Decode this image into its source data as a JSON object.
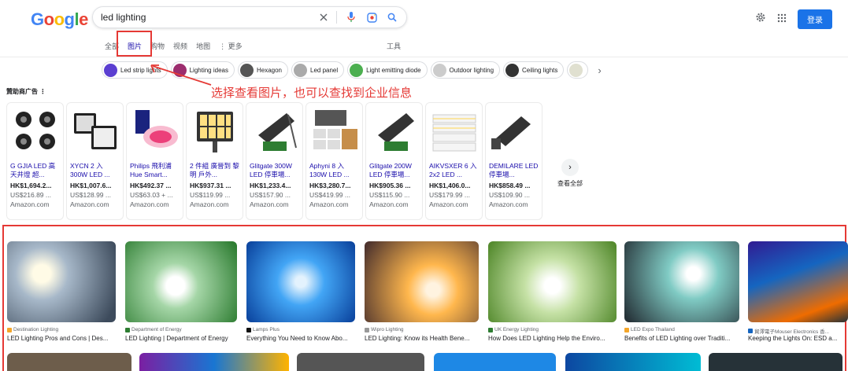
{
  "header": {
    "logo_letters": [
      {
        "ch": "G",
        "color": "#4285F4"
      },
      {
        "ch": "o",
        "color": "#EA4335"
      },
      {
        "ch": "o",
        "color": "#FBBC05"
      },
      {
        "ch": "g",
        "color": "#4285F4"
      },
      {
        "ch": "l",
        "color": "#34A853"
      },
      {
        "ch": "e",
        "color": "#EA4335"
      }
    ],
    "search_value": "led lighting",
    "signin_label": "登录"
  },
  "tabs": [
    {
      "label": "全部",
      "active": false
    },
    {
      "label": "图片",
      "active": true
    },
    {
      "label": "购物",
      "active": false
    },
    {
      "label": "视频",
      "active": false
    },
    {
      "label": "地图",
      "active": false
    },
    {
      "label": "⋮ 更多",
      "active": false
    }
  ],
  "tools_label": "工具",
  "chips": [
    {
      "label": "Led strip lights",
      "thumb": "#5b3fd1"
    },
    {
      "label": "Lighting ideas",
      "thumb": "#9c2d6e"
    },
    {
      "label": "Hexagon",
      "thumb": "#555555"
    },
    {
      "label": "Led panel",
      "thumb": "#aaaaaa"
    },
    {
      "label": "Light emitting diode",
      "thumb": "#4caf50"
    },
    {
      "label": "Outdoor lighting",
      "thumb": "#cccccc"
    },
    {
      "label": "Ceiling lights",
      "thumb": "#333333"
    },
    {
      "label": "",
      "thumb": "#e0e0d0"
    }
  ],
  "annotation": "选择查看图片，也可以查找到企业信息",
  "sponsored_label": "贊助商广告",
  "products": [
    {
      "title": "G GJIA LED 高天井燈 超...",
      "price": "HK$1,694.2...",
      "usd": "US$216.89 ...",
      "store": "Amazon.com"
    },
    {
      "title": "XYCN 2 入 300W LED ...",
      "price": "HK$1,007.6...",
      "usd": "US$128.99 ...",
      "store": "Amazon.com"
    },
    {
      "title": "Philips 飛利浦 Hue Smart...",
      "price": "HK$492.37 ...",
      "usd": "US$63.03 + ...",
      "store": "Amazon.com"
    },
    {
      "title": "2 件組 廣晉到 黎明 戶外...",
      "price": "HK$937.31 ...",
      "usd": "US$119.99 ...",
      "store": "Amazon.com"
    },
    {
      "title": "Glitgate 300W LED 停車場...",
      "price": "HK$1,233.4...",
      "usd": "US$157.90 ...",
      "store": "Amazon.com"
    },
    {
      "title": "Aphyni 8 入 130W LED ...",
      "price": "HK$3,280.7...",
      "usd": "US$419.99 ...",
      "store": "Amazon.com"
    },
    {
      "title": "Glitgate 200W LED 停車場...",
      "price": "HK$905.36 ...",
      "usd": "US$115.90 ...",
      "store": "Amazon.com"
    },
    {
      "title": "AIKVSXER 6 入 2x2 LED ...",
      "price": "HK$1,406.0...",
      "usd": "US$179.99 ...",
      "store": "Amazon.com"
    },
    {
      "title": "DEMILARE LED 停車場...",
      "price": "HK$858.49 ...",
      "usd": "US$109.90 ...",
      "store": "Amazon.com"
    }
  ],
  "view_all_label": "查看全部",
  "images": [
    {
      "source": "Destination Lighting",
      "title": "LED Lighting Pros and Cons | Des...",
      "fav": "#f4a62a"
    },
    {
      "source": "Department of Energy",
      "title": "LED Lighting | Department of Energy",
      "fav": "#2e7d32"
    },
    {
      "source": "Lamps Plus",
      "title": "Everything You Need to Know Abo...",
      "fav": "#111111"
    },
    {
      "source": "Wipro Lighting",
      "title": "LED Lighting: Know its Health Bene...",
      "fav": "#999999"
    },
    {
      "source": "UK Energy Lighting",
      "title": "How Does LED Lighting Help the Enviro...",
      "fav": "#2e7d32"
    },
    {
      "source": "LED Expo Thailand",
      "title": "Benefits of LED Lighting over Traditi...",
      "fav": "#f4a62a"
    },
    {
      "source": "貿澤電子Mouser Electronics 香...",
      "title": "Keeping the Lights On: ESD a...",
      "fav": "#1565c0"
    }
  ]
}
